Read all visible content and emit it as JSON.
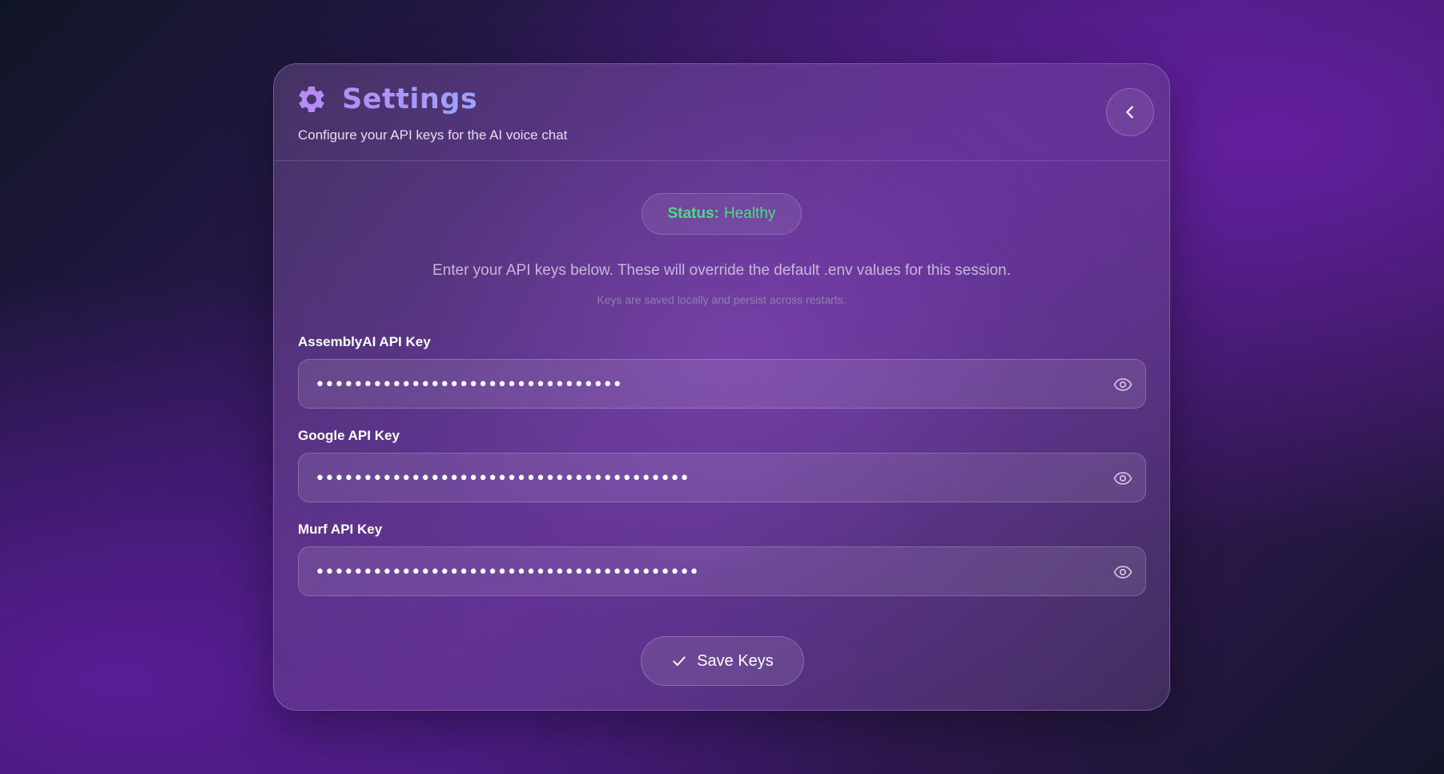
{
  "header": {
    "title": "Settings",
    "subtitle": "Configure your API keys for the AI voice chat",
    "icon": "gear-icon",
    "back_icon": "chevron-left-icon"
  },
  "status": {
    "label": "Status:",
    "value": "Healthy",
    "color": "#4ade80"
  },
  "intro": {
    "text": "Enter your API keys below. These will override the default .env values for this session.",
    "note": "Keys are saved locally and persist across restarts."
  },
  "fields": [
    {
      "label": "AssemblyAI API Key",
      "value": "••••••••••••••••••••••••••••••••",
      "icon": "eye-icon"
    },
    {
      "label": "Google API Key",
      "value": "•••••••••••••••••••••••••••••••••••••••",
      "icon": "eye-icon"
    },
    {
      "label": "Murf API Key",
      "value": "••••••••••••••••••••••••••••••••••••••••",
      "icon": "eye-icon"
    }
  ],
  "save": {
    "label": "Save Keys",
    "icon": "check-icon"
  },
  "colors": {
    "accent_start": "#b58cf5",
    "accent_end": "#9aa4ff",
    "status": "#4ade80"
  }
}
